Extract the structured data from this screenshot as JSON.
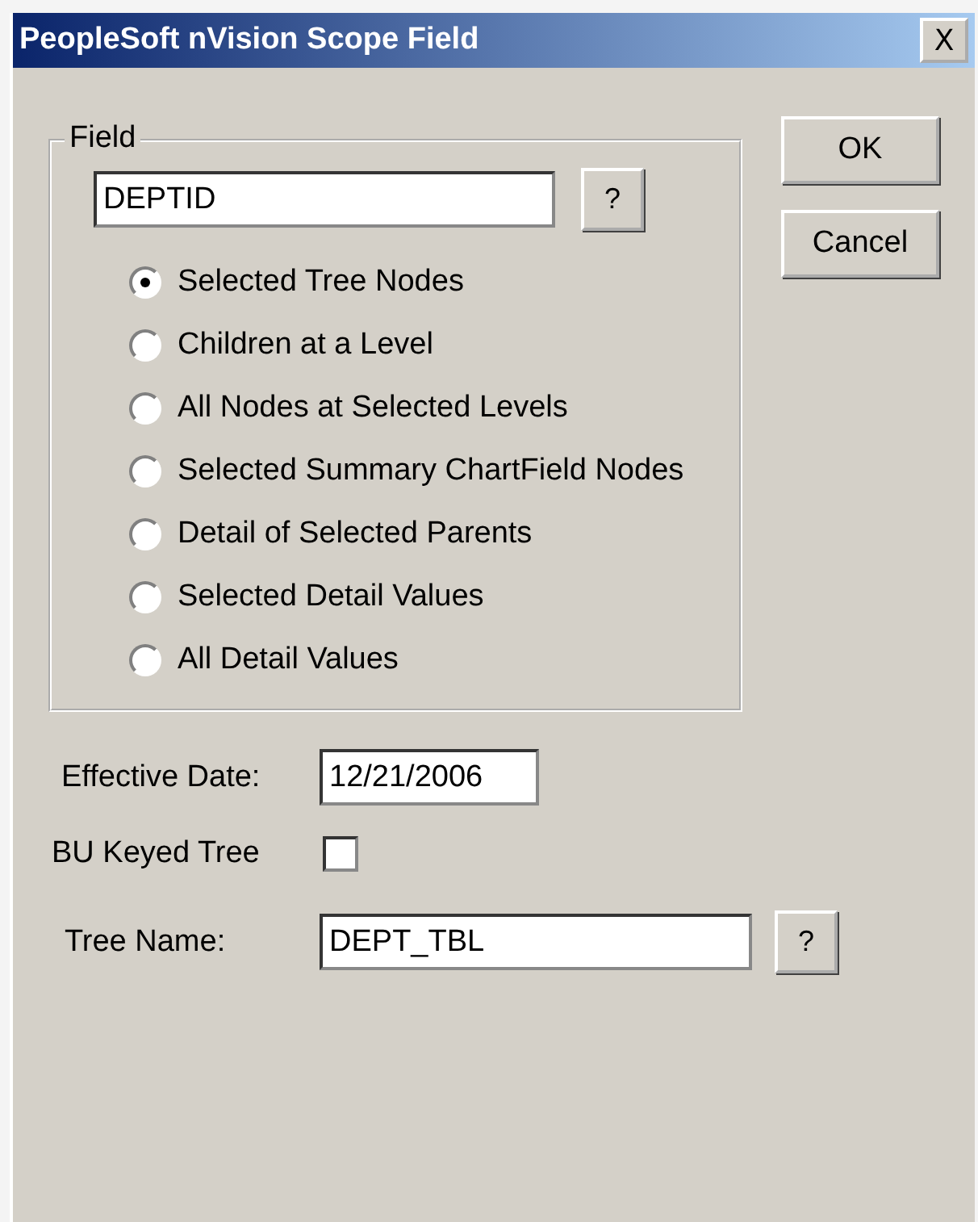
{
  "window": {
    "title": "PeopleSoft nVision Scope Field",
    "close": "X"
  },
  "field_group": {
    "legend": "Field",
    "value": "DEPTID",
    "lookup": "?",
    "options": [
      {
        "label": "Selected Tree Nodes",
        "selected": true
      },
      {
        "label": "Children at a Level",
        "selected": false
      },
      {
        "label": "All Nodes at Selected Levels",
        "selected": false
      },
      {
        "label": "Selected Summary ChartField Nodes",
        "selected": false
      },
      {
        "label": "Detail of Selected Parents",
        "selected": false
      },
      {
        "label": "Selected Detail Values",
        "selected": false
      },
      {
        "label": "All Detail Values",
        "selected": false
      }
    ]
  },
  "buttons": [
    "OK",
    "Cancel"
  ],
  "effective_date": {
    "label": "Effective Date:",
    "value": "12/21/2006"
  },
  "bu_keyed_tree": {
    "label": "BU Keyed Tree",
    "checked": false
  },
  "tree_name": {
    "label": "Tree Name:",
    "value": "DEPT_TBL",
    "lookup": "?"
  }
}
